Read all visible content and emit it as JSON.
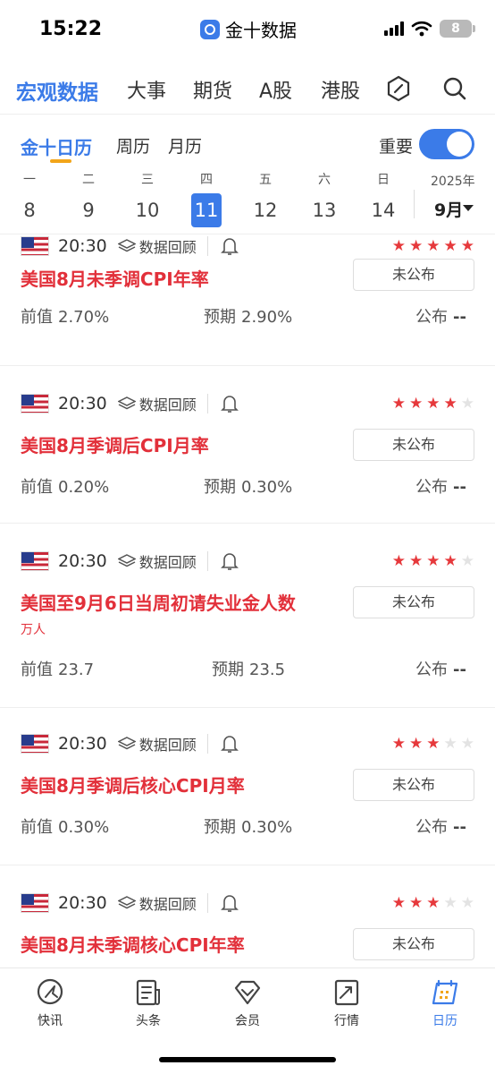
{
  "status_bar": {
    "time": "15:22",
    "app_name": "金十数据",
    "battery": "8"
  },
  "top_nav": {
    "tabs": [
      "宏观数据",
      "大事",
      "期货",
      "A股",
      "港股"
    ],
    "icons": [
      "hexagon-icon",
      "search-icon"
    ]
  },
  "sub_nav": {
    "tabs": [
      "金十日历",
      "周历",
      "月历"
    ],
    "important_label": "重要",
    "important_on": true
  },
  "week": {
    "days": [
      {
        "name": "一",
        "num": "8"
      },
      {
        "name": "二",
        "num": "9"
      },
      {
        "name": "三",
        "num": "10"
      },
      {
        "name": "四",
        "num": "11"
      },
      {
        "name": "五",
        "num": "12"
      },
      {
        "name": "六",
        "num": "13"
      },
      {
        "name": "日",
        "num": "14"
      }
    ],
    "selected_index": 3,
    "year": "2025年",
    "month": "9月"
  },
  "events": [
    {
      "time": "20:30",
      "review": "数据回顾",
      "stars": 5,
      "title": "美国8月未季调CPI年率",
      "unit": "",
      "status": "未公布",
      "prev_label": "前值",
      "prev": "2.70%",
      "forecast_label": "预期",
      "forecast": "2.90%",
      "published_label": "公布",
      "published": "--"
    },
    {
      "time": "20:30",
      "review": "数据回顾",
      "stars": 4,
      "title": "美国8月季调后CPI月率",
      "unit": "",
      "status": "未公布",
      "prev_label": "前值",
      "prev": "0.20%",
      "forecast_label": "预期",
      "forecast": "0.30%",
      "published_label": "公布",
      "published": "--"
    },
    {
      "time": "20:30",
      "review": "数据回顾",
      "stars": 4,
      "title": "美国至9月6日当周初请失业金人数",
      "unit": "万人",
      "status": "未公布",
      "prev_label": "前值",
      "prev": "23.7",
      "forecast_label": "预期",
      "forecast": "23.5",
      "published_label": "公布",
      "published": "--"
    },
    {
      "time": "20:30",
      "review": "数据回顾",
      "stars": 3,
      "title": "美国8月季调后核心CPI月率",
      "unit": "",
      "status": "未公布",
      "prev_label": "前值",
      "prev": "0.30%",
      "forecast_label": "预期",
      "forecast": "0.30%",
      "published_label": "公布",
      "published": "--"
    },
    {
      "time": "20:30",
      "review": "数据回顾",
      "stars": 3,
      "title": "美国8月未季调核心CPI年率",
      "unit": "",
      "status": "未公布",
      "prev_label": "",
      "prev": "",
      "forecast_label": "",
      "forecast": "",
      "published_label": "",
      "published": ""
    }
  ],
  "tab_bar": {
    "items": [
      {
        "label": "快讯",
        "icon": "flash-news-icon"
      },
      {
        "label": "头条",
        "icon": "headline-icon"
      },
      {
        "label": "会员",
        "icon": "vip-diamond-icon"
      },
      {
        "label": "行情",
        "icon": "market-chart-icon"
      },
      {
        "label": "日历",
        "icon": "calendar-icon"
      }
    ],
    "active_index": 4
  },
  "colors": {
    "accent": "#3b7be8",
    "title_red": "#e2303a",
    "star_red": "#e6393c",
    "underline_orange": "#f2a51a"
  }
}
